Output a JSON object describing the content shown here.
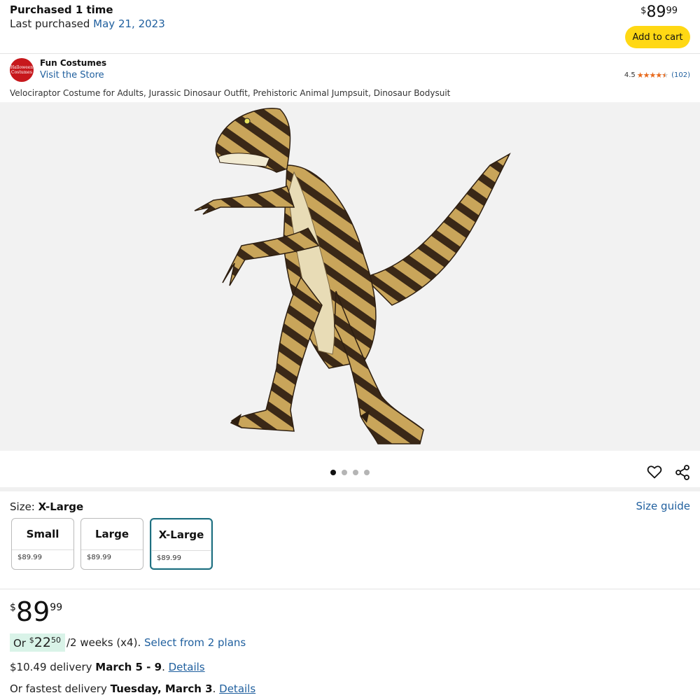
{
  "purchase": {
    "title": "Purchased 1 time",
    "last_label": "Last purchased",
    "last_date": "May 21, 2023"
  },
  "top_price": {
    "currency": "$",
    "dollars": "89",
    "cents": "99"
  },
  "add_to_cart_label": "Add to cart",
  "seller": {
    "logo_text": "Halloween Costumes",
    "name": "Fun Costumes",
    "visit_label": "Visit the Store"
  },
  "rating": {
    "value": "4.5",
    "stars": 4.5,
    "count": "(102)"
  },
  "product_title": "Velociraptor Costume for Adults, Jurassic Dinosaur Outfit, Prehistoric Animal Jumpsuit, Dinosaur Bodysuit",
  "carousel": {
    "total": 4,
    "active": 1
  },
  "icons": {
    "wishlist": "heart-icon",
    "share": "share-icon"
  },
  "size": {
    "label": "Size:",
    "selected": "X-Large",
    "guide_label": "Size guide",
    "options": [
      {
        "name": "Small",
        "price": "$89.99",
        "selected": false
      },
      {
        "name": "Large",
        "price": "$89.99",
        "selected": false
      },
      {
        "name": "X-Large",
        "price": "$89.99",
        "selected": true
      }
    ]
  },
  "main_price": {
    "currency": "$",
    "dollars": "89",
    "cents": "99"
  },
  "installment": {
    "prefix": "Or",
    "currency": "$",
    "dollars": "22",
    "cents": "50",
    "suffix": "/2 weeks (x4).",
    "link": "Select from 2 plans"
  },
  "delivery": {
    "standard": {
      "price_text": "$10.49 delivery",
      "dates": "March 5 - 9",
      "link": "Details"
    },
    "fastest": {
      "prefix": "Or fastest delivery",
      "date": "Tuesday, March 3",
      "link": "Details"
    }
  },
  "colors": {
    "link": "#1f5f9e",
    "cart_button": "#ffd814",
    "installment_bg": "#d9f3e8",
    "selected_border": "#1f6f80",
    "star": "#e86a1d",
    "seller_logo": "#c7181c"
  }
}
